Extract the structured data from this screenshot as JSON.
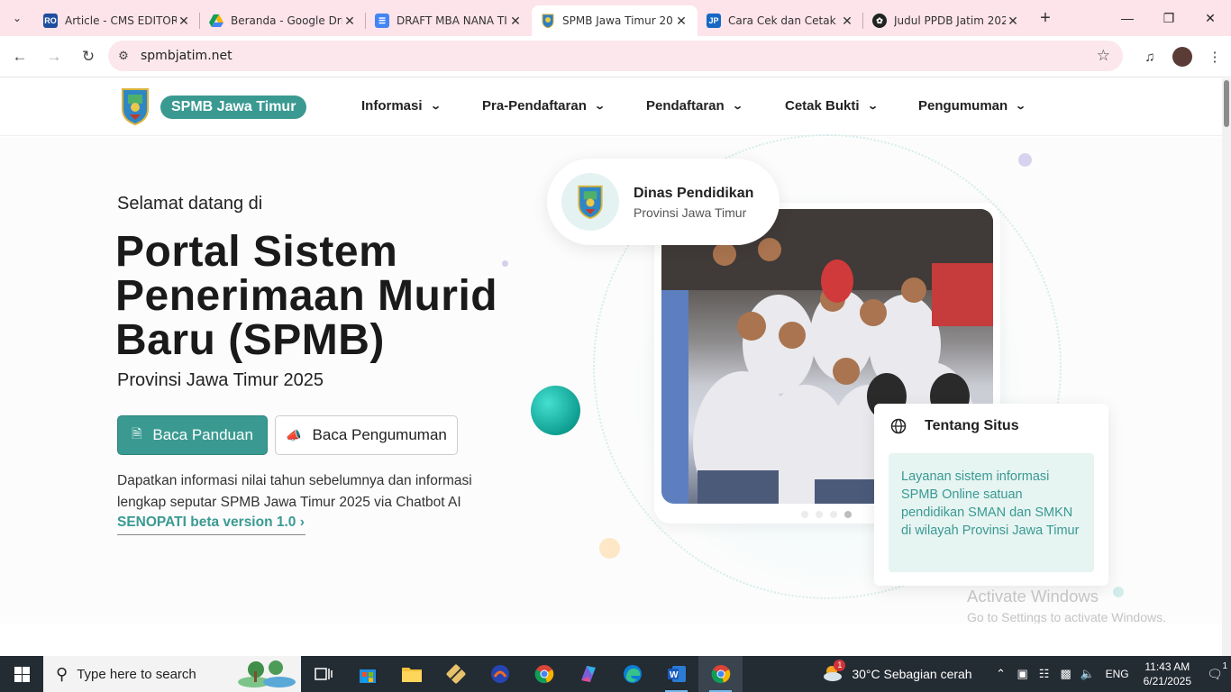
{
  "browser": {
    "tabs": [
      {
        "title": "Article - CMS EDITOR",
        "favicon": "RO",
        "favicon_color": "#1e4e9e",
        "active": false
      },
      {
        "title": "Beranda - Google Dri",
        "favicon": "drive",
        "favicon_color": "#f4b400",
        "active": false
      },
      {
        "title": "DRAFT MBA NANA TI",
        "favicon": "docs",
        "favicon_color": "#4285f4",
        "active": false
      },
      {
        "title": "SPMB Jawa Timur 20",
        "favicon": "crest",
        "favicon_color": "#3a9a92",
        "active": true
      },
      {
        "title": "Cara Cek dan Cetak E",
        "favicon": "JP",
        "favicon_color": "#1668c4",
        "active": false
      },
      {
        "title": "Judul PPDB Jatim 202",
        "favicon": "ai",
        "favicon_color": "#222222",
        "active": false
      }
    ],
    "url": "spmbjatim.net"
  },
  "site": {
    "brand": "SPMB Jawa Timur",
    "menu": [
      "Informasi",
      "Pra-Pendaftaran",
      "Pendaftaran",
      "Cetak Bukti",
      "Pengumuman"
    ]
  },
  "hero": {
    "greeting": "Selamat datang di",
    "title": "Portal Sistem Penerimaan Murid Baru (SPMB)",
    "subtitle": "Provinsi Jawa Timur 2025",
    "btn_primary": "Baca Panduan",
    "btn_secondary": "Baca Pengumuman",
    "description": "Dapatkan informasi nilai tahun sebelumnya dan informasi lengkap seputar SPMB Jawa Timur 2025 via Chatbot AI",
    "link": "SENOPATI beta version 1.0"
  },
  "dinas": {
    "name": "Dinas Pendidikan",
    "sub": "Provinsi Jawa Timur"
  },
  "about": {
    "title": "Tentang Situs",
    "body": "Layanan sistem informasi SPMB Online satuan pendidikan SMAN dan SMKN di wilayah Provinsi Jawa Timur"
  },
  "carousel": {
    "count": 4,
    "active_index": 3
  },
  "watermark": {
    "line1": "Activate Windows",
    "line2": "Go to Settings to activate Windows."
  },
  "taskbar": {
    "search_placeholder": "Type here to search",
    "weather": "30°C  Sebagian cerah",
    "weather_badge": "1",
    "lang": "ENG",
    "time": "11:43 AM",
    "date": "6/21/2025",
    "notif_count": "1"
  },
  "colors": {
    "accent": "#3a9a92",
    "tab_bar": "#fde3ea"
  }
}
